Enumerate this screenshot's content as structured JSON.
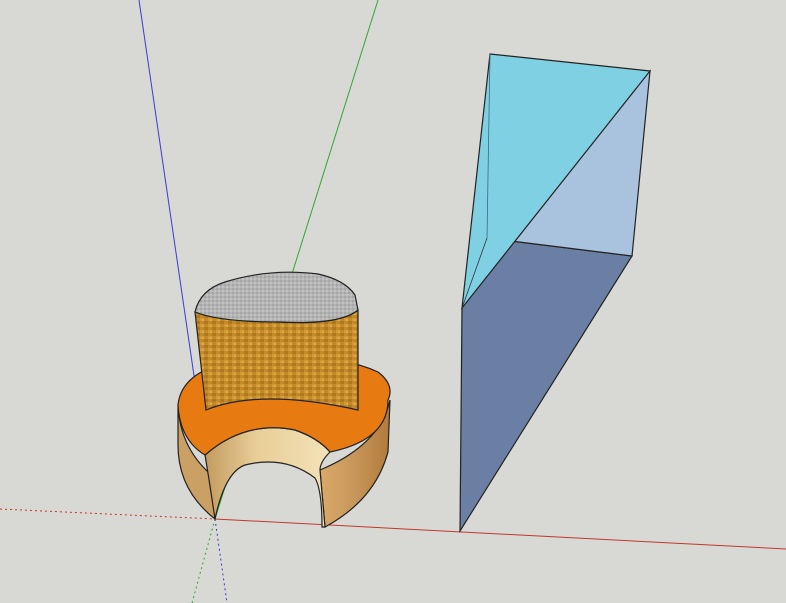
{
  "app": {
    "type": "3d-modeling-viewport"
  },
  "viewport": {
    "background_color": "#d8d8d5",
    "axes": {
      "red_axis_color": "#c0392b",
      "green_axis_color": "#2faa2f",
      "blue_axis_color": "#3b3bd1"
    },
    "objects": [
      {
        "name": "cylinder-object",
        "materials": {
          "top_cap_color": "#b4b4b4",
          "side_texture_color": "#c48a2a",
          "ring_top_color": "#e87a12",
          "ring_outer_color": "#c8965a",
          "ring_inner_color": "#e8cd97"
        }
      },
      {
        "name": "wedge-object",
        "materials": {
          "upper_face_color": "#7fd0e3",
          "right_face_color": "#a9c3df",
          "lower_face_color": "#6a7fa3"
        }
      }
    ]
  }
}
